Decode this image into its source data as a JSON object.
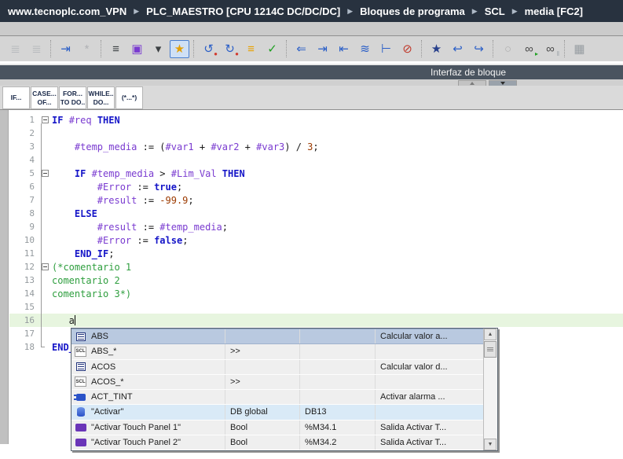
{
  "breadcrumb": {
    "items": [
      "www.tecnoplc.com_VPN",
      "PLC_MAESTRO [CPU 1214C DC/DC/DC]",
      "Bloques de programa",
      "SCL",
      "media [FC2]"
    ],
    "separator_icon": "breadcrumb-arrow-icon"
  },
  "interface_bar": {
    "title": "Interfaz de bloque"
  },
  "toolbar": {
    "icons": [
      {
        "name": "compile-icon",
        "glyph": "≣",
        "color": "#9aa0a6",
        "disabled": true
      },
      {
        "name": "compile-changes-icon",
        "glyph": "≣",
        "color": "#9aa0a6",
        "disabled": true,
        "sep": true
      },
      {
        "name": "download-to-device-icon",
        "glyph": "⇥",
        "color": "#2b5fc7"
      },
      {
        "name": "snapshot-icon",
        "glyph": "*",
        "color": "#8c9096",
        "disabled": true,
        "sep": true
      },
      {
        "name": "network-list-icon",
        "glyph": "≡",
        "color": "#3c4043"
      },
      {
        "name": "goto-network-icon",
        "glyph": "▣",
        "color": "#7a3bd0"
      },
      {
        "name": "insert-comment-icon",
        "glyph": "▾",
        "color": "#3c4043"
      },
      {
        "name": "favorites-icon",
        "glyph": "★",
        "color": "#e3a008",
        "active": true,
        "sep": true
      },
      {
        "name": "undo-icon",
        "glyph": "↺",
        "color": "#2b5fc7",
        "badge": "●",
        "badge_color": "#d23b2e"
      },
      {
        "name": "redo-icon",
        "glyph": "↻",
        "color": "#2b5fc7",
        "badge": "●",
        "badge_color": "#d23b2e"
      },
      {
        "name": "sort-blocks-icon",
        "glyph": "≡",
        "color": "#e8a000"
      },
      {
        "name": "consistency-check-icon",
        "glyph": "✓",
        "color": "#1fa022",
        "sep": true
      },
      {
        "name": "collapse-indent-icon",
        "glyph": "⇐",
        "color": "#2b5fc7"
      },
      {
        "name": "indent-icon",
        "glyph": "⇥",
        "color": "#2b5fc7"
      },
      {
        "name": "outdent-icon",
        "glyph": "⇤",
        "color": "#2b5fc7"
      },
      {
        "name": "format-code-icon",
        "glyph": "≋",
        "color": "#2b5fc7"
      },
      {
        "name": "show-marks-icon",
        "glyph": "⊢",
        "color": "#2b5fc7"
      },
      {
        "name": "hide-marks-icon",
        "glyph": "⊘",
        "color": "#c0392b",
        "sep": true
      },
      {
        "name": "set-bookmark-icon",
        "glyph": "★",
        "color": "#28408c"
      },
      {
        "name": "previous-bookmark-icon",
        "glyph": "↩",
        "color": "#2b5fc7"
      },
      {
        "name": "next-bookmark-icon",
        "glyph": "↪",
        "color": "#2b5fc7",
        "sep": true
      },
      {
        "name": "monitor-search-icon",
        "glyph": "○",
        "color": "#8a8a8a",
        "disabled": true
      },
      {
        "name": "monitoring-on-icon",
        "glyph": "∞",
        "color": "#4a4a4a",
        "badge": "▸",
        "badge_color": "#1fa022"
      },
      {
        "name": "monitoring-off-icon",
        "glyph": "∞",
        "color": "#4a4a4a",
        "badge": "‖",
        "badge_color": "#9aa0a6",
        "sep": true
      },
      {
        "name": "split-editor-icon",
        "glyph": "▦",
        "color": "#5b6770",
        "disabled": true
      }
    ]
  },
  "splitter": {
    "up_button": "collapse-up",
    "down_button": "collapse-down"
  },
  "snippet_tabs": [
    {
      "name": "tab-if",
      "label": "IF..."
    },
    {
      "name": "tab-case-of",
      "label": "CASE...\nOF..."
    },
    {
      "name": "tab-for-to-do",
      "label": "FOR...\nTO DO.."
    },
    {
      "name": "tab-while-do",
      "label": "WHILE..\nDO..."
    },
    {
      "name": "tab-comment",
      "label": "(*...*)"
    }
  ],
  "editor": {
    "current_line": 16,
    "caret_line": 16,
    "lines": [
      {
        "n": 1,
        "fold": true,
        "tk": [
          [
            "k",
            "IF"
          ],
          [
            "p",
            " "
          ],
          [
            "v",
            "#req"
          ],
          [
            "p",
            " "
          ],
          [
            "k",
            "THEN"
          ]
        ]
      },
      {
        "n": 2,
        "tk": []
      },
      {
        "n": 3,
        "tk": [
          [
            "p",
            "    "
          ],
          [
            "v",
            "#temp_media"
          ],
          [
            "p",
            " := ("
          ],
          [
            "v",
            "#var1"
          ],
          [
            "p",
            " + "
          ],
          [
            "v",
            "#var2"
          ],
          [
            "p",
            " + "
          ],
          [
            "v",
            "#var3"
          ],
          [
            "p",
            ") / "
          ],
          [
            "n",
            "3"
          ],
          [
            "p",
            ";"
          ]
        ]
      },
      {
        "n": 4,
        "tk": []
      },
      {
        "n": 5,
        "fold": true,
        "tk": [
          [
            "p",
            "    "
          ],
          [
            "k",
            "IF"
          ],
          [
            "p",
            " "
          ],
          [
            "v",
            "#temp_media"
          ],
          [
            "p",
            " > "
          ],
          [
            "v",
            "#Lim_Val"
          ],
          [
            "p",
            " "
          ],
          [
            "k",
            "THEN"
          ]
        ]
      },
      {
        "n": 6,
        "tk": [
          [
            "p",
            "        "
          ],
          [
            "v",
            "#Error"
          ],
          [
            "p",
            " := "
          ],
          [
            "k",
            "true"
          ],
          [
            "p",
            ";"
          ]
        ]
      },
      {
        "n": 7,
        "tk": [
          [
            "p",
            "        "
          ],
          [
            "v",
            "#result"
          ],
          [
            "p",
            " := "
          ],
          [
            "n",
            "-99.9"
          ],
          [
            "p",
            ";"
          ]
        ]
      },
      {
        "n": 8,
        "tk": [
          [
            "p",
            "    "
          ],
          [
            "k",
            "ELSE"
          ]
        ]
      },
      {
        "n": 9,
        "tk": [
          [
            "p",
            "        "
          ],
          [
            "v",
            "#result"
          ],
          [
            "p",
            " := "
          ],
          [
            "v",
            "#temp_media"
          ],
          [
            "p",
            ";"
          ]
        ]
      },
      {
        "n": 10,
        "tk": [
          [
            "p",
            "        "
          ],
          [
            "v",
            "#Error"
          ],
          [
            "p",
            " := "
          ],
          [
            "k",
            "false"
          ],
          [
            "p",
            ";"
          ]
        ]
      },
      {
        "n": 11,
        "tk": [
          [
            "p",
            "    "
          ],
          [
            "k",
            "END_IF"
          ],
          [
            "p",
            ";"
          ]
        ]
      },
      {
        "n": 12,
        "fold": true,
        "tk": [
          [
            "c",
            "(*comentario 1"
          ]
        ]
      },
      {
        "n": 13,
        "tk": [
          [
            "c",
            "comentario 2"
          ]
        ]
      },
      {
        "n": 14,
        "tk": [
          [
            "c",
            "comentario 3*)"
          ]
        ]
      },
      {
        "n": 15,
        "tk": []
      },
      {
        "n": 16,
        "tk": [
          [
            "p",
            "   a"
          ]
        ]
      },
      {
        "n": 17,
        "tk": []
      },
      {
        "n": 18,
        "tk": [
          [
            "k",
            "END_IF"
          ],
          [
            "p",
            ";"
          ]
        ]
      }
    ]
  },
  "autocomplete": {
    "icon_labels": {
      "scl": "SCL"
    },
    "rows": [
      {
        "icon": "fn",
        "icon_name": "instruction-icon",
        "name": "ABS",
        "type": "",
        "address": "",
        "comment": "Calcular valor a...",
        "selected": true
      },
      {
        "icon": "scl",
        "icon_name": "scl-icon",
        "name": "ABS_*",
        "type": ">>",
        "address": "",
        "comment": ""
      },
      {
        "icon": "fn",
        "icon_name": "instruction-icon",
        "name": "ACOS",
        "type": "",
        "address": "",
        "comment": "Calcular valor d..."
      },
      {
        "icon": "scl",
        "icon_name": "scl-icon",
        "name": "ACOS_*",
        "type": ">>",
        "address": "",
        "comment": ""
      },
      {
        "icon": "sys",
        "icon_name": "system-function-icon",
        "name": "ACT_TINT",
        "type": "",
        "address": "",
        "comment": "Activar alarma ..."
      },
      {
        "icon": "db",
        "icon_name": "data-block-icon",
        "name": "\"Activar\"",
        "type": "DB global",
        "address": "DB13",
        "comment": "",
        "highlight": "blue"
      },
      {
        "icon": "tag",
        "icon_name": "output-tag-icon",
        "name": "\"Activar Touch Panel 1\"",
        "type": "Bool",
        "address": "%M34.1",
        "comment": "Salida Activar T..."
      },
      {
        "icon": "tag",
        "icon_name": "output-tag-icon",
        "name": "\"Activar Touch Panel 2\"",
        "type": "Bool",
        "address": "%M34.2",
        "comment": "Salida Activar T..."
      }
    ],
    "scrollbar": {
      "up_icon": "▲",
      "down_icon": "▼"
    }
  },
  "colors": {
    "breadcrumb_bg": "#28323f",
    "interface_bar_bg": "#4a545f",
    "current_line_bg": "#e7f5df",
    "keyword": "#1616c8",
    "variable": "#7a3bd0",
    "number": "#9c3a00",
    "comment": "#2e9e3e",
    "selected_row_bg": "#b9c9e0",
    "db_row_bg": "#d9eaf7"
  }
}
